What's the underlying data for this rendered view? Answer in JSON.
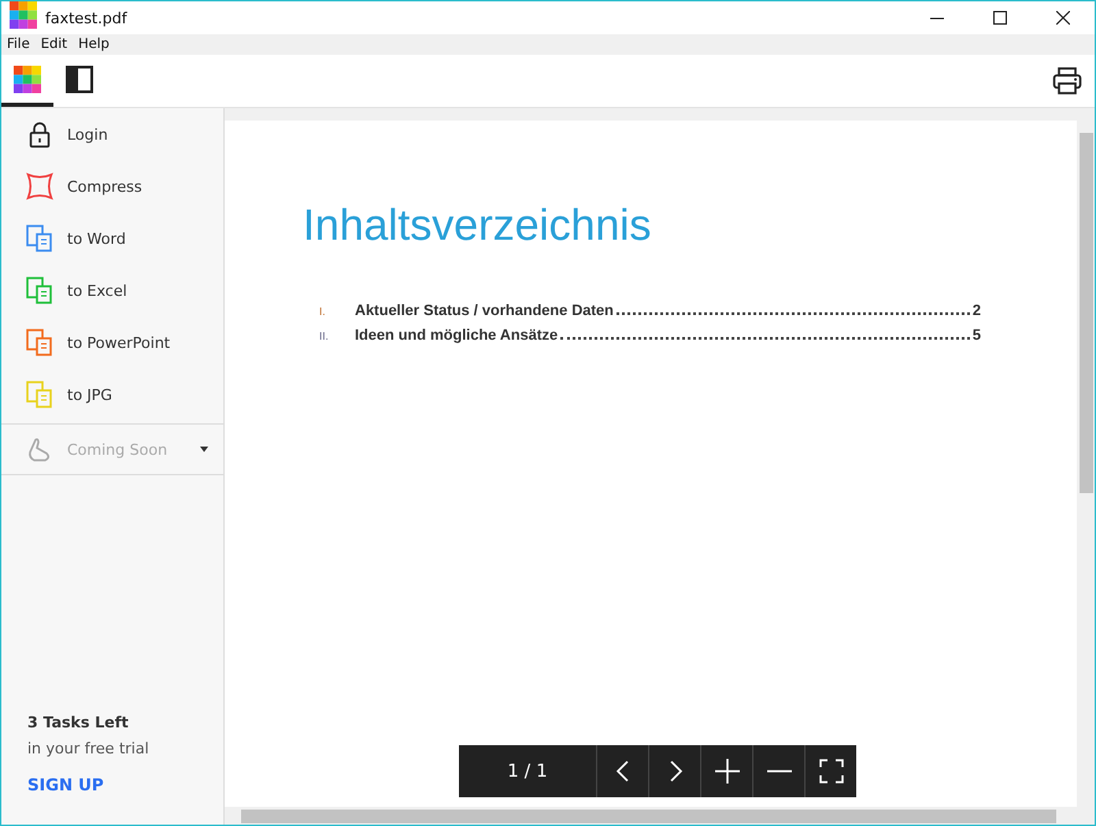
{
  "window": {
    "title": "faxtest.pdf"
  },
  "menu": [
    "File",
    "Edit",
    "Help"
  ],
  "toolbar_tabs": [
    {
      "kind": "palette",
      "selected": true
    },
    {
      "kind": "panel",
      "selected": false
    }
  ],
  "sidebar": {
    "items": [
      {
        "kind": "lock",
        "label": "Login",
        "disabled": false
      },
      {
        "kind": "compress",
        "label": "Compress",
        "disabled": false
      },
      {
        "kind": "word",
        "label": "to Word",
        "disabled": false
      },
      {
        "kind": "excel",
        "label": "to Excel",
        "disabled": false
      },
      {
        "kind": "powerpoint",
        "label": "to PowerPoint",
        "disabled": false
      },
      {
        "kind": "jpg",
        "label": "to JPG",
        "disabled": false
      },
      {
        "kind": "soon",
        "label": "Coming Soon",
        "disabled": true
      }
    ],
    "tasks_left": "3 Tasks Left",
    "trial_note": "in your free trial",
    "signup": "SIGN UP"
  },
  "document": {
    "heading": "Inhaltsverzeichnis",
    "toc": [
      {
        "numeral": "I.",
        "title": "Aktueller Status / vorhandene Daten",
        "page": "2"
      },
      {
        "numeral": "II.",
        "title": "Ideen und mögliche Ansätze",
        "page": "5"
      }
    ]
  },
  "page_nav": {
    "page": "1 / 1"
  }
}
